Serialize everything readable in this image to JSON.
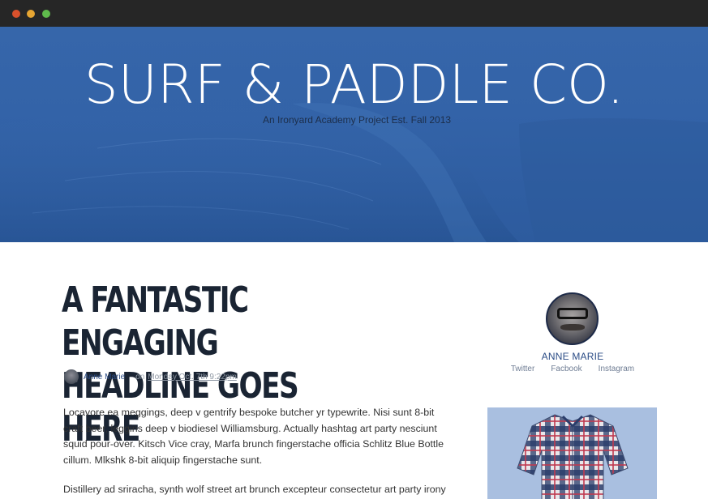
{
  "window": {
    "controls": [
      "close",
      "minimize",
      "maximize"
    ]
  },
  "hero": {
    "title": "SURF & PADDLE CO.",
    "subtitle": "An Ironyard Academy Project Est. Fall 2013"
  },
  "article": {
    "headline": "A FANTASTIC ENGAGING HEADLINE GOES HERE",
    "author": "Anne Marie",
    "on_label": "on",
    "date": "Monday Oct. 7th 9:22pm",
    "paragraphs": [
      "Locavore ea meggings, deep v gentrify bespoke butcher yr typewrite. Nisi sunt 8-bit craft beer, leggins deep v biodiesel Williamsburg. Actually hashtag art party nesciunt squid pour-over. Kitsch Vice cray, Marfa brunch fingerstache officia Schlitz Blue Bottle cillum. Mlkshk 8-bit aliquip fingerstache sunt.",
      "Distillery ad sriracha, synth wolf street art brunch excepteur consectetur art party irony"
    ]
  },
  "sidebar": {
    "name": "ANNE MARIE",
    "social": [
      "Twitter",
      "Facbook",
      "Instagram"
    ]
  },
  "colors": {
    "hero_blue": "#3363a8",
    "headline": "#1a2433",
    "link": "#2b4c86",
    "ad_background": "#a9bfe0"
  }
}
